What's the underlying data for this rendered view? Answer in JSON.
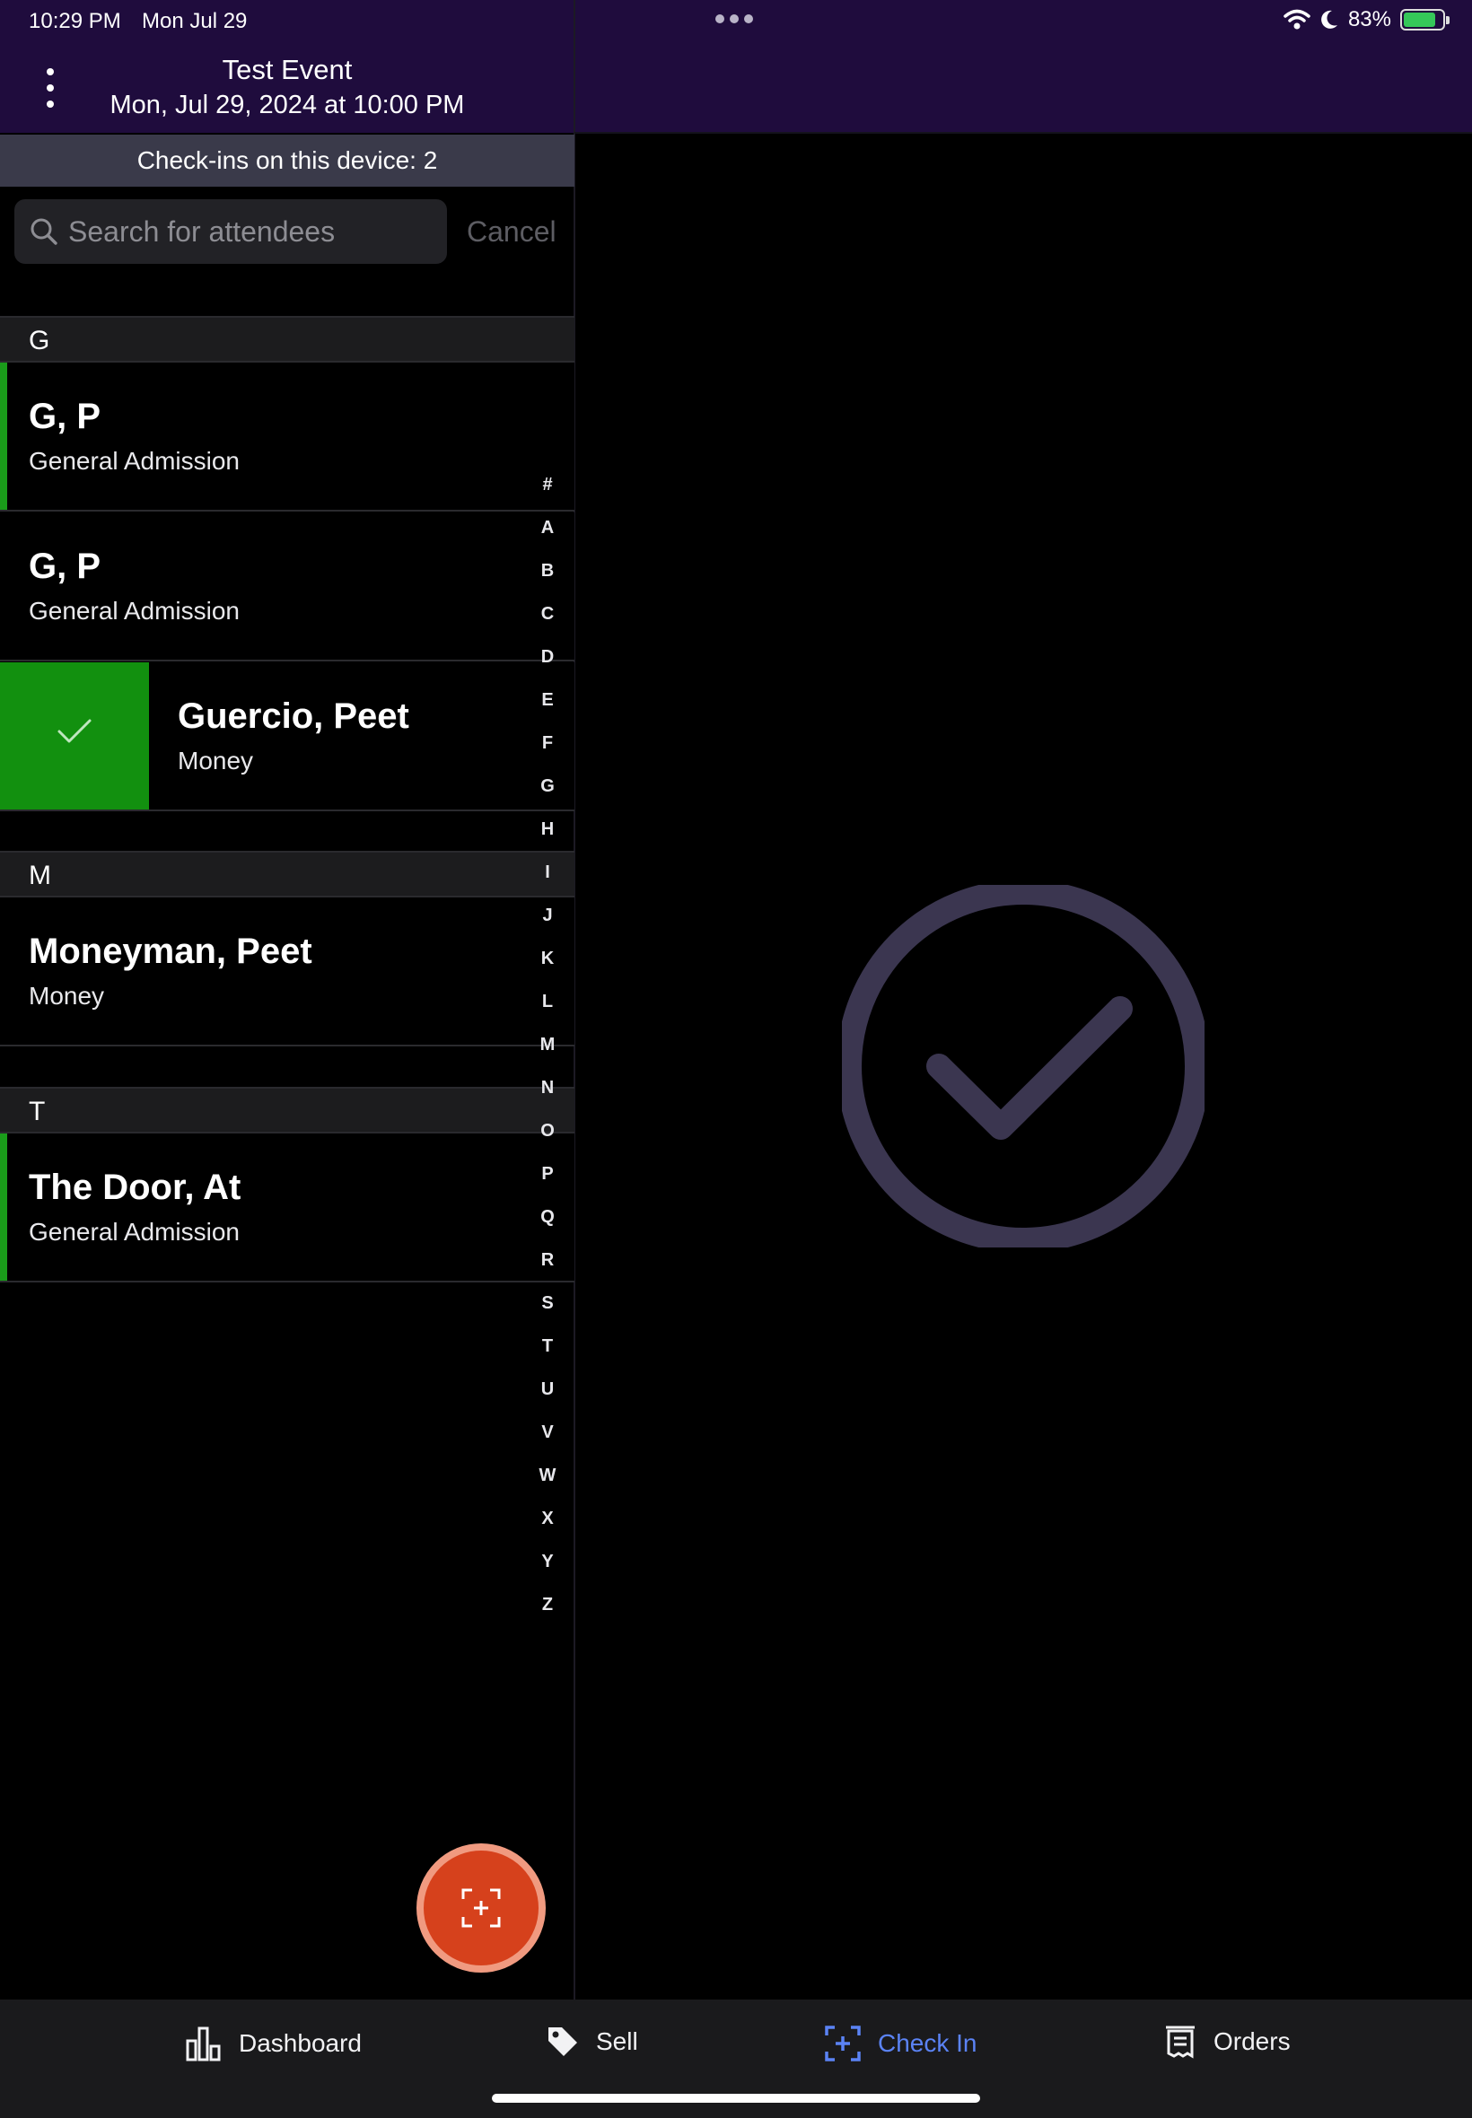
{
  "status": {
    "time": "10:29 PM",
    "date": "Mon Jul 29",
    "battery": "83%",
    "battery_level": 0.83
  },
  "header": {
    "title": "Test Event",
    "datetime": "Mon, Jul 29, 2024 at 10:00 PM",
    "menu_icon": "more-vertical-icon"
  },
  "checkins_banner": "Check-ins on this device: 2",
  "search": {
    "placeholder": "Search for attendees",
    "value": "",
    "cancel_label": "Cancel"
  },
  "sections": [
    {
      "letter": "G",
      "rows": [
        {
          "name": "G, P",
          "ticket": "General Admission",
          "checked_in": true
        },
        {
          "name": "G, P",
          "ticket": "General Admission",
          "checked_in": false
        },
        {
          "name": "Guercio, Peet",
          "ticket": "Money",
          "checked_in": false,
          "swipe_action": "check-icon"
        }
      ]
    },
    {
      "letter": "M",
      "rows": [
        {
          "name": "Moneyman, Peet",
          "ticket": "Money",
          "checked_in": false
        }
      ]
    },
    {
      "letter": "T",
      "rows": [
        {
          "name": "The Door, At",
          "ticket": "General Admission",
          "checked_in": true
        }
      ]
    }
  ],
  "index_letters": [
    "#",
    "A",
    "B",
    "C",
    "D",
    "E",
    "F",
    "G",
    "H",
    "I",
    "J",
    "K",
    "L",
    "M",
    "N",
    "O",
    "P",
    "Q",
    "R",
    "S",
    "T",
    "U",
    "V",
    "W",
    "X",
    "Y",
    "Z"
  ],
  "detail_icon": "check-circle-icon",
  "fab_icon": "scan-plus-icon",
  "tabs": [
    {
      "label": "Dashboard",
      "icon": "bar-chart-icon",
      "active": false
    },
    {
      "label": "Sell",
      "icon": "tag-icon",
      "active": false
    },
    {
      "label": "Check In",
      "icon": "scan-plus-icon",
      "active": true
    },
    {
      "label": "Orders",
      "icon": "receipt-icon",
      "active": false
    }
  ],
  "colors": {
    "header_bg": "#1f0c3d",
    "checked_in": "#1a9c1a",
    "fab": "#d6411c",
    "active_tab": "#5b83f5",
    "detail_check": "#3b3650"
  }
}
